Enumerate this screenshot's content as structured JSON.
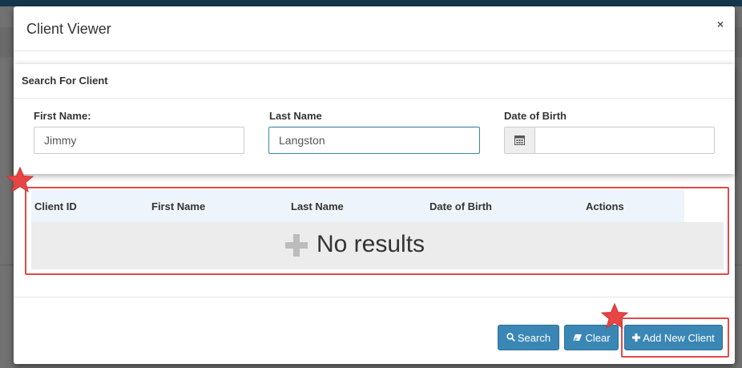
{
  "modal": {
    "title": "Client Viewer",
    "close": "×"
  },
  "search": {
    "heading": "Search For Client",
    "first_name_label": "First Name:",
    "first_name_value": "Jimmy",
    "last_name_label": "Last Name",
    "last_name_value": "Langston",
    "dob_label": "Date of Birth",
    "dob_value": "",
    "calendar_icon": "calendar-icon"
  },
  "results": {
    "columns": [
      "Client ID",
      "First Name",
      "Last Name",
      "Date of Birth",
      "Actions"
    ],
    "empty_text": "No results",
    "empty_icon": "plus-icon"
  },
  "footer": {
    "search_label": "Search",
    "clear_label": "Clear",
    "add_label": "Add New Client",
    "search_icon": "search-icon",
    "clear_icon": "eraser-icon",
    "add_icon": "plus-icon"
  },
  "colors": {
    "primary_button": "#3a87b5",
    "annotation": "#e04a4a",
    "table_header": "#eef4fb"
  }
}
